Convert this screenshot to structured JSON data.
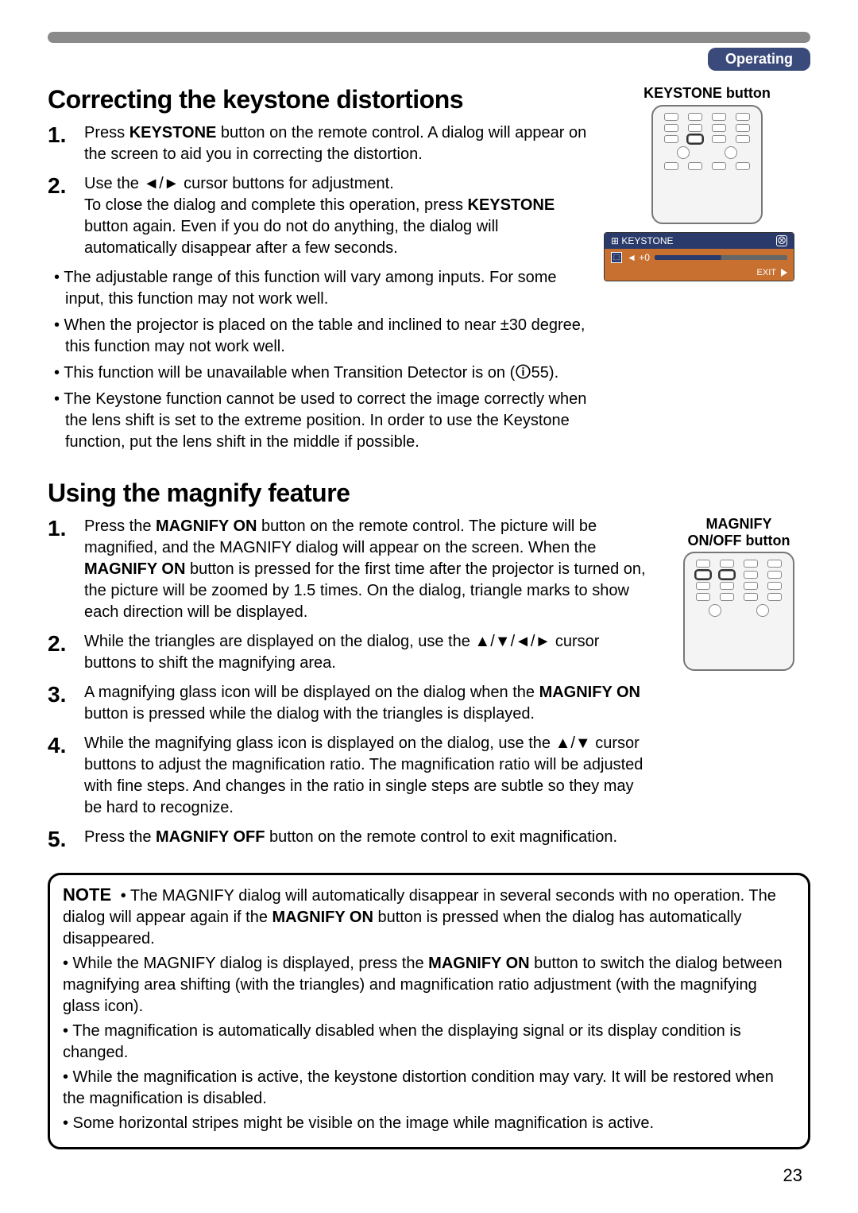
{
  "header": {
    "section_tag": "Operating"
  },
  "page_number": "23",
  "keystone": {
    "title": "Correcting the keystone distortions",
    "caption": "KEYSTONE button",
    "step1": {
      "pre": "Press ",
      "btn": "KEYSTONE",
      "post": " button on the remote control. A dialog will appear on the screen to aid you in correcting the distortion."
    },
    "step2": {
      "pre": "Use the ◄/► cursor buttons for adjustment.",
      "line2a": "To close the dialog and complete this operation, press ",
      "line2b": "KEYSTONE",
      "line2c": " button again. Even if you do not do anything, the dialog will automatically disappear after a few seconds."
    },
    "bul1": "• The adjustable range of this function will vary among inputs. For some input, this function may not work well.",
    "bul2": "• When the projector is placed on the table and inclined to near ±30 degree, this function may not work well.",
    "bul3": "• This function will be unavailable when Transition Detector is on (🛈55).",
    "bul4": "• The Keystone function cannot be used to correct the image correctly when the lens shift is set to the extreme position. In order to use the Keystone function, put the lens shift in the middle if possible.",
    "osd": {
      "title": "KEYSTONE",
      "value": "◄ +0",
      "exit": "EXIT"
    }
  },
  "magnify": {
    "title": "Using the magnify feature",
    "caption_top": "MAGNIFY",
    "caption_bottom": "ON/OFF button",
    "step1": {
      "l1a": "Press the ",
      "l1b": "MAGNIFY ON",
      "l1c": " button on the remote control.",
      "l2a": "The picture will be magnified, and the MAGNIFY dialog will appear on the screen. When the ",
      "l2b": "MAGNIFY ON",
      "l2c": " button is pressed for the first time after the projector is turned on, the picture will be zoomed by 1.5 times. On the dialog, triangle marks to show each direction will be displayed."
    },
    "step2": "While the triangles are displayed on the dialog, use the ▲/▼/◄/► cursor buttons to shift the magnifying area.",
    "step3": {
      "a": "A magnifying glass icon will be displayed on the dialog when the ",
      "b": "MAGNIFY ON",
      "c": " button is pressed while the dialog with the triangles is displayed."
    },
    "step4": "While the magnifying glass icon is displayed on the dialog, use the ▲/▼ cursor buttons to adjust the magnification ratio. The magnification ratio will be adjusted with fine steps. And changes in the ratio in single steps are subtle so they may be hard to recognize.",
    "step5": {
      "a": "Press the ",
      "b": "MAGNIFY OFF",
      "c": " button on the remote control to exit magnification."
    }
  },
  "note": {
    "label": "NOTE",
    "p1": "• The MAGNIFY dialog will automatically disappear in several seconds with no operation. The dialog will appear again if the ",
    "p1b": "MAGNIFY ON",
    "p1c": " button is pressed when the dialog has automatically disappeared.",
    "p2a": "• While the MAGNIFY dialog is displayed, press the ",
    "p2b": "MAGNIFY ON",
    "p2c": " button to switch the dialog between magnifying area shifting (with the triangles) and magnification ratio adjustment (with the magnifying glass icon).",
    "p3": "• The magnification is automatically disabled when the displaying signal or its display condition is changed.",
    "p4": "• While the magnification is active, the keystone distortion condition may vary. It will be restored when the magnification is disabled.",
    "p5": "• Some horizontal stripes might be visible on the image while magnification is active."
  }
}
